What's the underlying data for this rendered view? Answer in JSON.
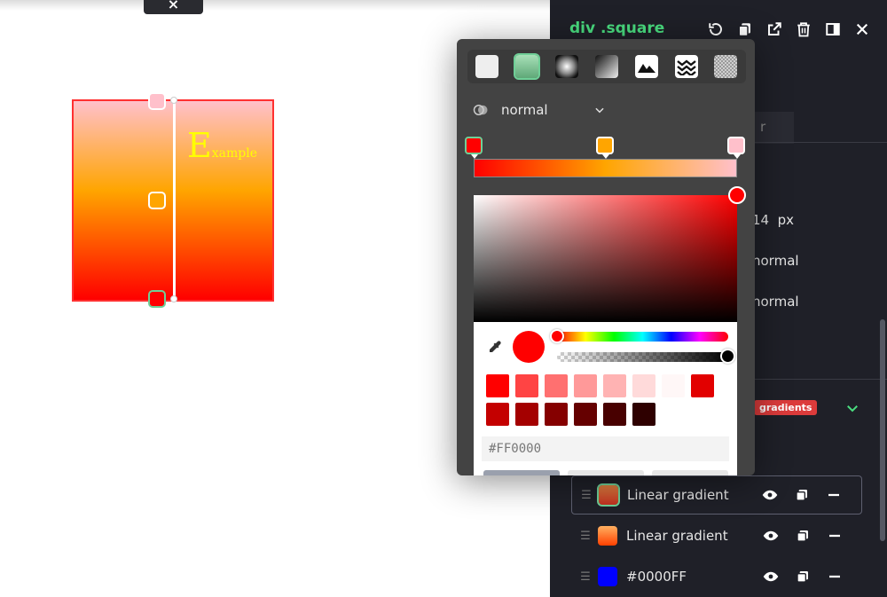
{
  "canvas": {
    "close_glyph": "×",
    "square_text_big": "E",
    "square_text_small": "xample"
  },
  "picker": {
    "fill_types": [
      "solid",
      "linear-gradient",
      "radial-gradient",
      "conic-gradient",
      "image",
      "pattern",
      "noise"
    ],
    "active_fill_type": "linear-gradient",
    "blend_mode": "normal",
    "gradient_stops": [
      {
        "color": "#FF0000",
        "position": 0
      },
      {
        "color": "#FFA500",
        "position": 0.5
      },
      {
        "color": "#FFC0CB",
        "position": 1
      }
    ],
    "hex_value": "#FF0000",
    "presets": [
      "#FF0000",
      "#FF4444",
      "#FF7070",
      "#FF9999",
      "#FFB3B3",
      "#FFDADA",
      "#FFF7F7",
      "#E20000",
      "#C40000",
      "#A40000",
      "#850000",
      "#650000",
      "#480000",
      "#2E0000"
    ]
  },
  "panel": {
    "title": "div .square",
    "tab_fragment": "r",
    "font_size_value": "14",
    "font_size_unit": "px",
    "prop_value_1": "normal",
    "prop_value_2": "normal",
    "badge": "gradients",
    "layers": [
      {
        "label": "Linear gradient",
        "swatch": "linear-gradient(#e08040,#c03020)",
        "selected": true
      },
      {
        "label": "Linear gradient",
        "swatch": "linear-gradient(#ffb060,#ff4000)",
        "selected": false
      },
      {
        "label": "#0000FF",
        "swatch": "#0000FF",
        "selected": false
      }
    ]
  },
  "colors": {
    "accent_green": "#4ADE80",
    "panel_bg": "#1F2028",
    "picker_bg": "#434343",
    "badge_red": "#DC3B3B"
  }
}
